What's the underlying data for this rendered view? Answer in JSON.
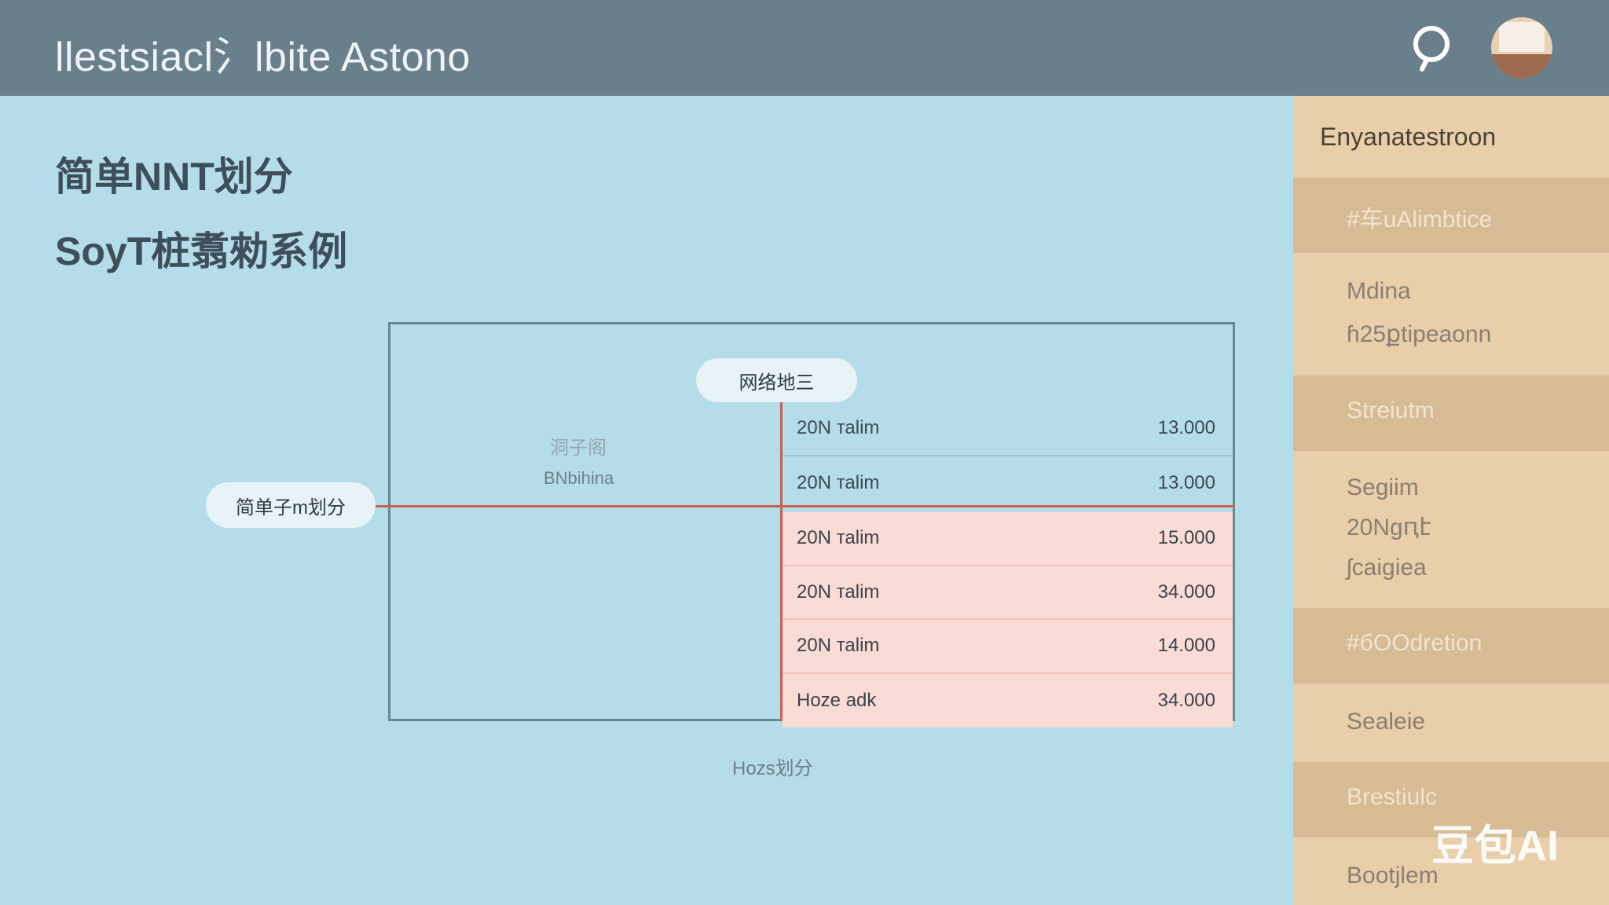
{
  "header": {
    "title": "llestsiacl氵lbite Astono",
    "search_icon": "search-icon",
    "avatar_icon": "avatar"
  },
  "main": {
    "heading_1": "简单NNT划分",
    "heading_2": "SoyT桩翥勑系例"
  },
  "diagram": {
    "top_node": "网络地三",
    "left_node": "简单子m划分",
    "center_label_1": "洞子阁",
    "center_label_2": "BNbihina",
    "caption": "Hozs划分",
    "rows": [
      {
        "label": "20N таlim",
        "value": "13.000",
        "highlighted": false
      },
      {
        "label": "20N таlim",
        "value": "13.000",
        "highlighted": false
      },
      {
        "label": "20N таlim",
        "value": "15.000",
        "highlighted": true
      },
      {
        "label": "20N таlim",
        "value": "34.000",
        "highlighted": true
      },
      {
        "label": "20N таlim",
        "value": "14.000",
        "highlighted": true
      },
      {
        "label": "Hoze adk",
        "value": "34.000",
        "highlighted": true
      }
    ],
    "colors": {
      "divider_line": "#c8604f",
      "highlight_row": "#fbdbd6",
      "border": "#6b8795"
    }
  },
  "sidebar": {
    "title": "Enyanatestroon",
    "bands": [
      "#车uAlimbtice",
      "Streiutm",
      "#бOOdretion",
      "Brestiulc"
    ],
    "items": {
      "item_1": "Mdina",
      "item_2": "ɦ25քtipeaonn",
      "item_3": "Segiim",
      "item_4": "20Nɡԥէ",
      "item_5": "ʃcaigiea",
      "item_6": "Sealeie",
      "item_7": "Bootjlem"
    }
  },
  "watermark": "豆包AI",
  "theme": {
    "background": "#b4dde9",
    "header": "#697f8c",
    "sidebar": "#e8cfaa",
    "sidebar_band": "#d6bb95"
  }
}
